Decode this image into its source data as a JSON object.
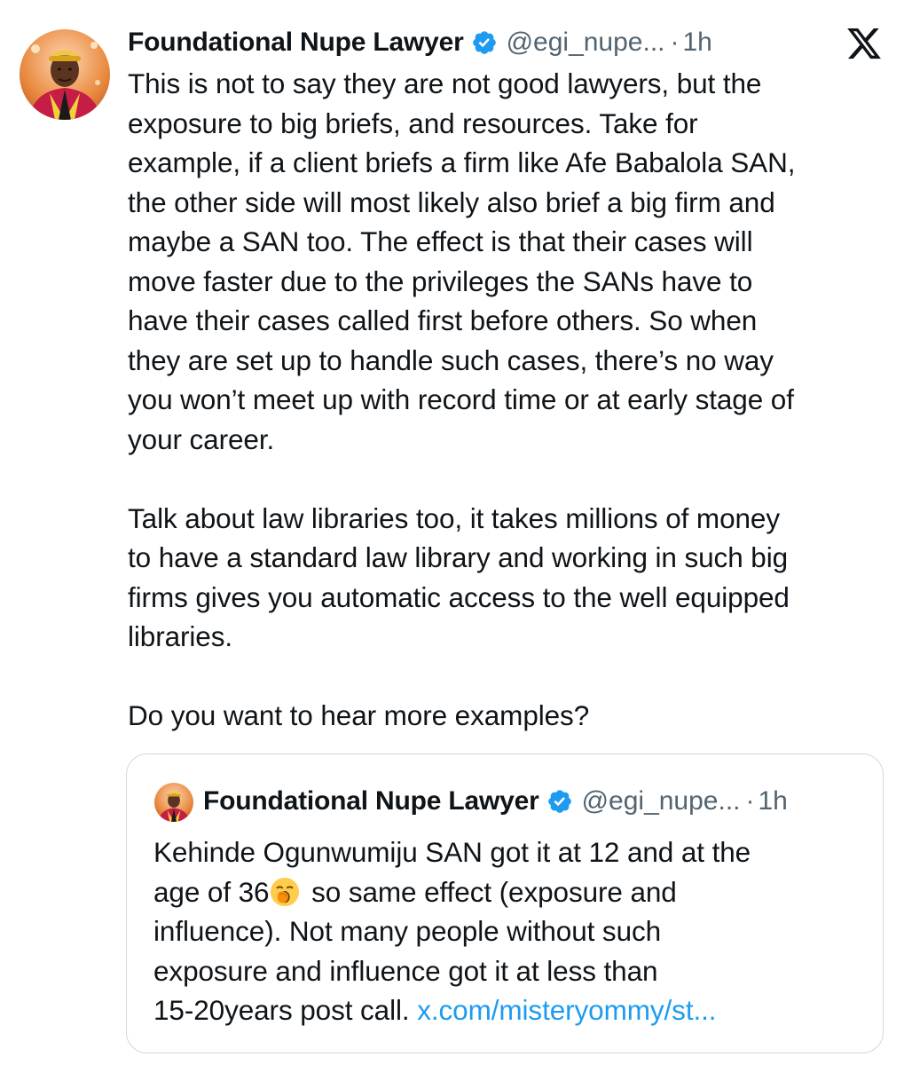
{
  "tweet": {
    "author": {
      "display_name": "Foundational Nupe Lawyer",
      "handle": "@egi_nupe...",
      "verified": true,
      "avatar": "profile-photo"
    },
    "separator": "·",
    "time": "1h",
    "platform_icon": "x-logo-icon",
    "text": "This is not to say they are not good lawyers, but the\nexposure to big briefs, and resources. Take for\nexample, if a client briefs a firm like Afe Babalola SAN,\nthe other side will most likely also brief a big firm and\nmaybe a SAN too. The effect is that their cases will\nmove faster due to the privileges the SANs have to\nhave their cases called first before others. So when\nthey are set up to handle such cases, there’s no way\nyou won’t meet up with record time or at early stage of\nyour career.\n\nTalk about law libraries too, it takes millions of money\nto have a standard law library and working in such big\nfirms gives you automatic access to the well equipped\nlibraries.\n\nDo you want to hear more examples?"
  },
  "quoted_tweet": {
    "author": {
      "display_name": "Foundational Nupe Lawyer",
      "handle": "@egi_nupe...",
      "verified": true,
      "avatar": "profile-photo"
    },
    "separator": "·",
    "time": "1h",
    "lines": {
      "l1": "Kehinde Ogunwumiju SAN got it at 12 and at the",
      "l2_before": "age of 36",
      "l2_emoji": "yawning-face-emoji",
      "l2_after": " so same effect (exposure and",
      "l3": "influence). Not many people without such",
      "l4": "exposure and influence got it at less than",
      "l5_text": "15-20years post call. ",
      "l5_link": "x.com/misteryommy/st..."
    }
  },
  "colors": {
    "text": "#0f1419",
    "secondary": "#536471",
    "link": "#1d9bf0",
    "verified_badge": "#1d9bf0",
    "border": "#cfd9de"
  }
}
